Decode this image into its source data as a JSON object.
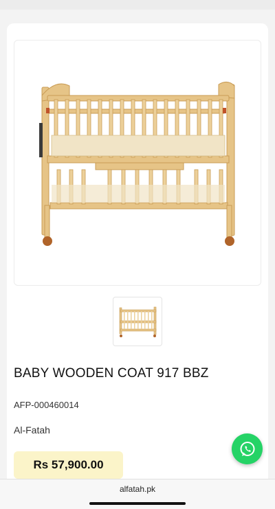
{
  "product": {
    "title": "BABY WOODEN COAT 917 BBZ",
    "sku": "AFP-000460014",
    "brand": "Al-Fatah",
    "price": "Rs 57,900.00"
  },
  "browser": {
    "url": "alfatah.pk"
  },
  "icons": {
    "chat": "whatsapp-icon"
  },
  "colors": {
    "price_background": "#fbf4c9",
    "whatsapp": "#25d366",
    "wood": "#e8c98c"
  }
}
